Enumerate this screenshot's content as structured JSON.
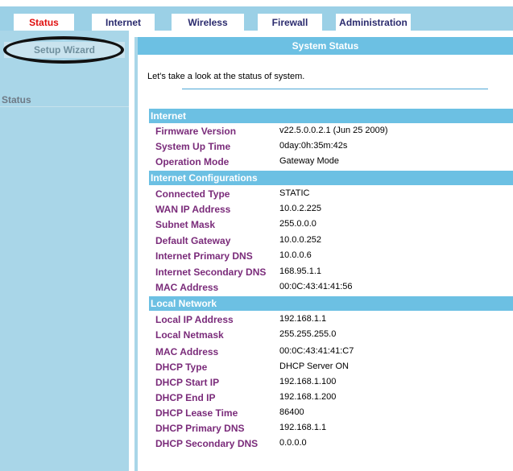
{
  "tabs": [
    {
      "label": "Status"
    },
    {
      "label": "Internet"
    },
    {
      "label": "Wireless"
    },
    {
      "label": "Firewall"
    },
    {
      "label": "Administration"
    }
  ],
  "sidebar": {
    "wizard_label": "Setup Wizard",
    "status_label": "Status"
  },
  "main": {
    "title": "System Status",
    "intro": "Let's take a look at the status of system.",
    "sections": [
      {
        "heading": "Internet",
        "rows": [
          {
            "label": "Firmware Version",
            "value": "v22.5.0.0.2.1 (Jun 25 2009)"
          },
          {
            "label": "System Up Time",
            "value": "0day:0h:35m:42s"
          },
          {
            "label": "Operation Mode",
            "value": "Gateway Mode"
          }
        ]
      },
      {
        "heading": "Internet Configurations",
        "rows": [
          {
            "label": "Connected Type",
            "value": "STATIC"
          },
          {
            "label": "WAN IP Address",
            "value": "10.0.2.225"
          },
          {
            "label": "Subnet Mask",
            "value": "255.0.0.0"
          },
          {
            "label": "Default Gateway",
            "value": "10.0.0.252"
          },
          {
            "label": "Internet Primary DNS",
            "value": "10.0.0.6"
          },
          {
            "label": "Internet Secondary DNS",
            "value": "168.95.1.1"
          },
          {
            "label": "MAC Address",
            "value": "00:0C:43:41:41:56"
          }
        ]
      },
      {
        "heading": "Local Network",
        "rows": [
          {
            "label": "Local IP Address",
            "value": "192.168.1.1"
          },
          {
            "label": "Local Netmask",
            "value": "255.255.255.0"
          },
          {
            "label": "MAC Address",
            "value": "00:0C:43:41:41:C7"
          },
          {
            "label": "DHCP Type",
            "value": "DHCP Server ON"
          },
          {
            "label": "DHCP Start IP",
            "value": "192.168.1.100"
          },
          {
            "label": "DHCP End IP",
            "value": "192.168.1.200"
          },
          {
            "label": "DHCP Lease Time",
            "value": "86400"
          },
          {
            "label": "DHCP Primary DNS",
            "value": "192.168.1.1"
          },
          {
            "label": "DHCP Secondary DNS",
            "value": "0.0.0.0"
          }
        ]
      }
    ]
  },
  "colors": {
    "tab_bar": "#9bd0e6",
    "active_tab_text": "#e01010",
    "section_header": "#6cc0e3",
    "label_text": "#7a2b7a",
    "sidebar": "#a9d6e8"
  }
}
